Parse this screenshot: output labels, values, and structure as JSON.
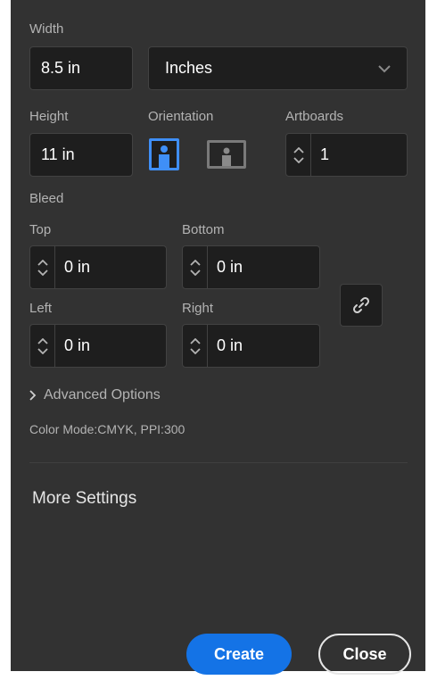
{
  "width": {
    "label": "Width",
    "value": "8.5 in",
    "units": "Inches"
  },
  "height": {
    "label": "Height",
    "value": "11 in"
  },
  "orientation": {
    "label": "Orientation",
    "selected": "portrait"
  },
  "artboards": {
    "label": "Artboards",
    "value": "1"
  },
  "bleed": {
    "label": "Bleed",
    "top": {
      "label": "Top",
      "value": "0 in"
    },
    "bottom": {
      "label": "Bottom",
      "value": "0 in"
    },
    "left": {
      "label": "Left",
      "value": "0 in"
    },
    "right": {
      "label": "Right",
      "value": "0 in"
    }
  },
  "advanced": {
    "label": "Advanced Options"
  },
  "info": {
    "color_mode": "Color Mode:CMYK, PPI:300"
  },
  "more_settings": {
    "title": "More Settings"
  },
  "actions": {
    "create_label": "Create",
    "close_label": "Close"
  },
  "colors": {
    "panel": "#323232",
    "field": "#1e1e1e",
    "accent": "#1473e6",
    "selected_orientation": "#3f8ff7"
  }
}
